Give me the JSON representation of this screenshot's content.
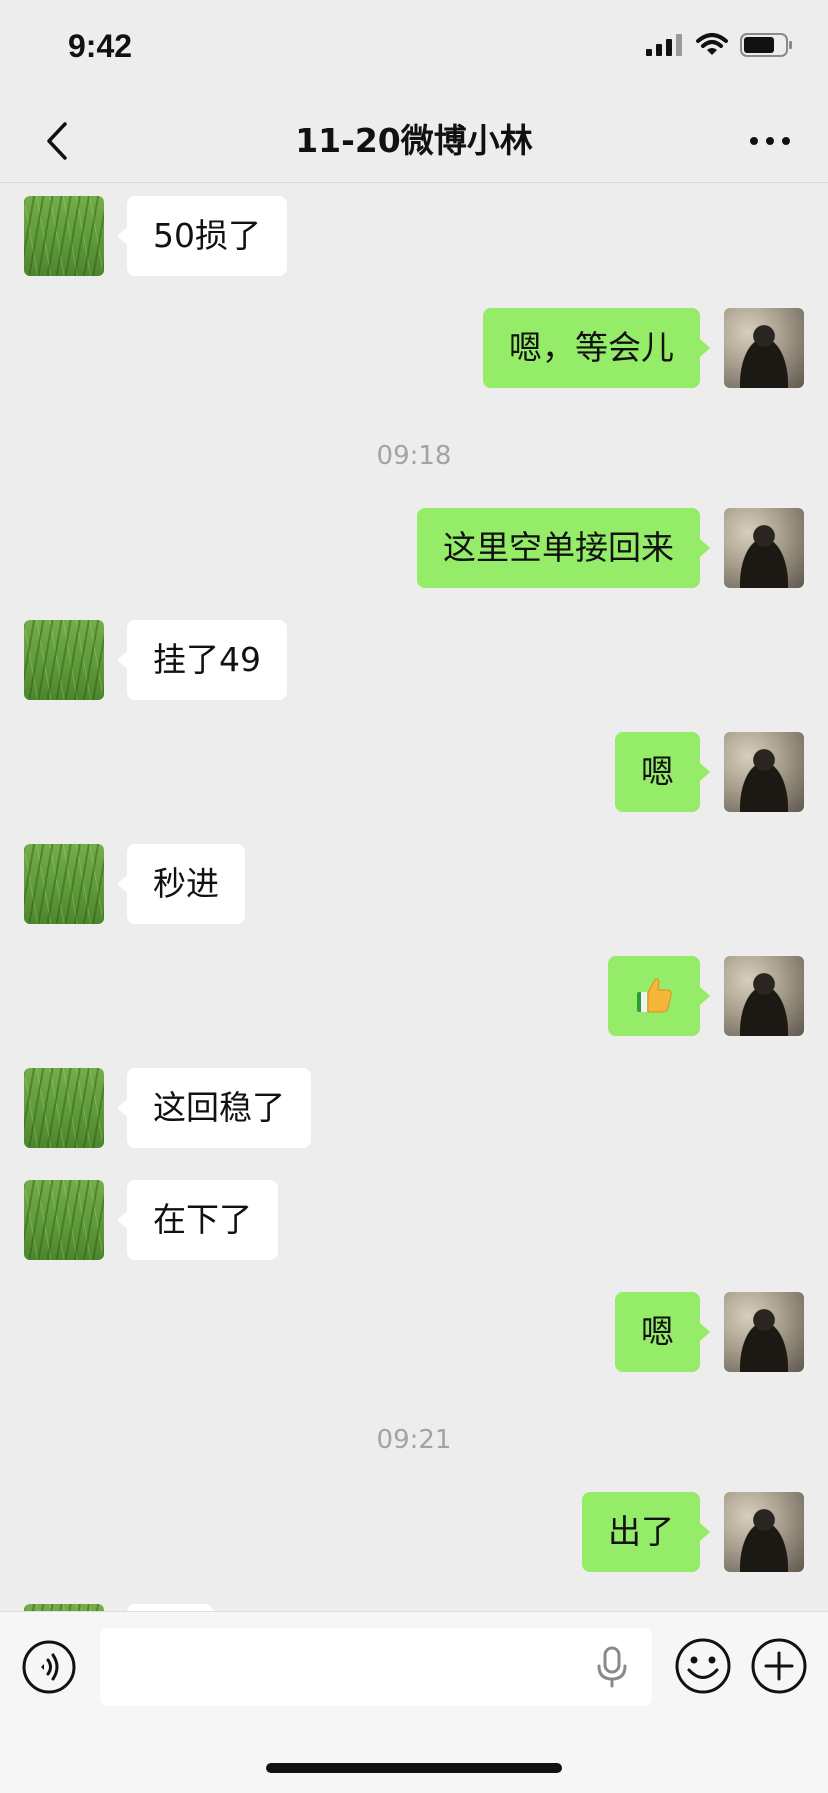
{
  "status_bar": {
    "time": "9:42"
  },
  "nav": {
    "title": "11-20微博小林"
  },
  "icons": {
    "back": "chevron-left-icon",
    "more": "more-dots-icon",
    "voice": "voice-mode-icon",
    "mic": "microphone-icon",
    "emoji": "emoji-icon",
    "plus": "plus-icon",
    "thumbs_up": "thumbs-up-emoji"
  },
  "colors": {
    "background": "#ededed",
    "incoming_bubble": "#ffffff",
    "outgoing_bubble": "#95ec69",
    "timestamp_text": "#a3a3a3"
  },
  "messages": [
    {
      "side": "left",
      "text": "50损了"
    },
    {
      "side": "right",
      "text": "嗯，等会儿"
    },
    {
      "timestamp": "09:18"
    },
    {
      "side": "right",
      "text": "这里空单接回来"
    },
    {
      "side": "left",
      "text": "挂了49"
    },
    {
      "side": "right",
      "text": "嗯"
    },
    {
      "side": "left",
      "text": "秒进"
    },
    {
      "side": "right",
      "emoji": "thumbs-up"
    },
    {
      "side": "left",
      "text": "这回稳了"
    },
    {
      "side": "left",
      "text": "在下了"
    },
    {
      "side": "right",
      "text": "嗯"
    },
    {
      "timestamp": "09:21"
    },
    {
      "side": "right",
      "text": "出了"
    }
  ],
  "input": {
    "value": "",
    "placeholder": ""
  }
}
